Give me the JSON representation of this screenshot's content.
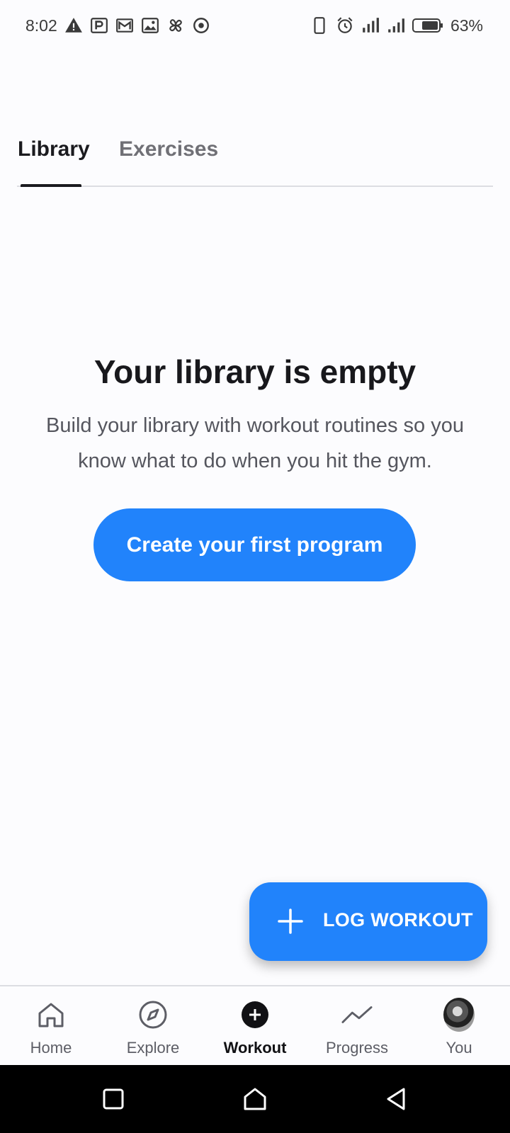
{
  "status_bar": {
    "time": "8:02",
    "battery_percent": "63%",
    "left_icons": [
      "warning-icon",
      "parking-icon",
      "mail-icon",
      "image-icon",
      "pinwheel-icon",
      "target-icon"
    ],
    "right_icons": [
      "phone-vibrate-icon",
      "alarm-icon",
      "signal-icon",
      "signal-icon",
      "battery-icon"
    ]
  },
  "tabs": [
    {
      "label": "Library",
      "active": true
    },
    {
      "label": "Exercises",
      "active": false
    }
  ],
  "empty_state": {
    "title": "Your library is empty",
    "body": "Build your library with workout routines so you know what to do when you hit the gym.",
    "cta_label": "Create your first program"
  },
  "fab": {
    "label": "LOG WORKOUT",
    "icon": "plus-icon"
  },
  "bottom_nav": {
    "items": [
      {
        "label": "Home",
        "icon": "home-icon",
        "active": false
      },
      {
        "label": "Explore",
        "icon": "compass-icon",
        "active": false
      },
      {
        "label": "Workout",
        "icon": "add-circle-icon",
        "active": true
      },
      {
        "label": "Progress",
        "icon": "trend-icon",
        "active": false
      },
      {
        "label": "You",
        "icon": "avatar",
        "active": false
      }
    ]
  },
  "system_nav": [
    "recents-button",
    "home-button",
    "back-button"
  ],
  "colors": {
    "accent": "#2183fb",
    "background": "#fcfcfe",
    "text_primary": "#1b1b1f",
    "text_secondary": "#55565e"
  }
}
